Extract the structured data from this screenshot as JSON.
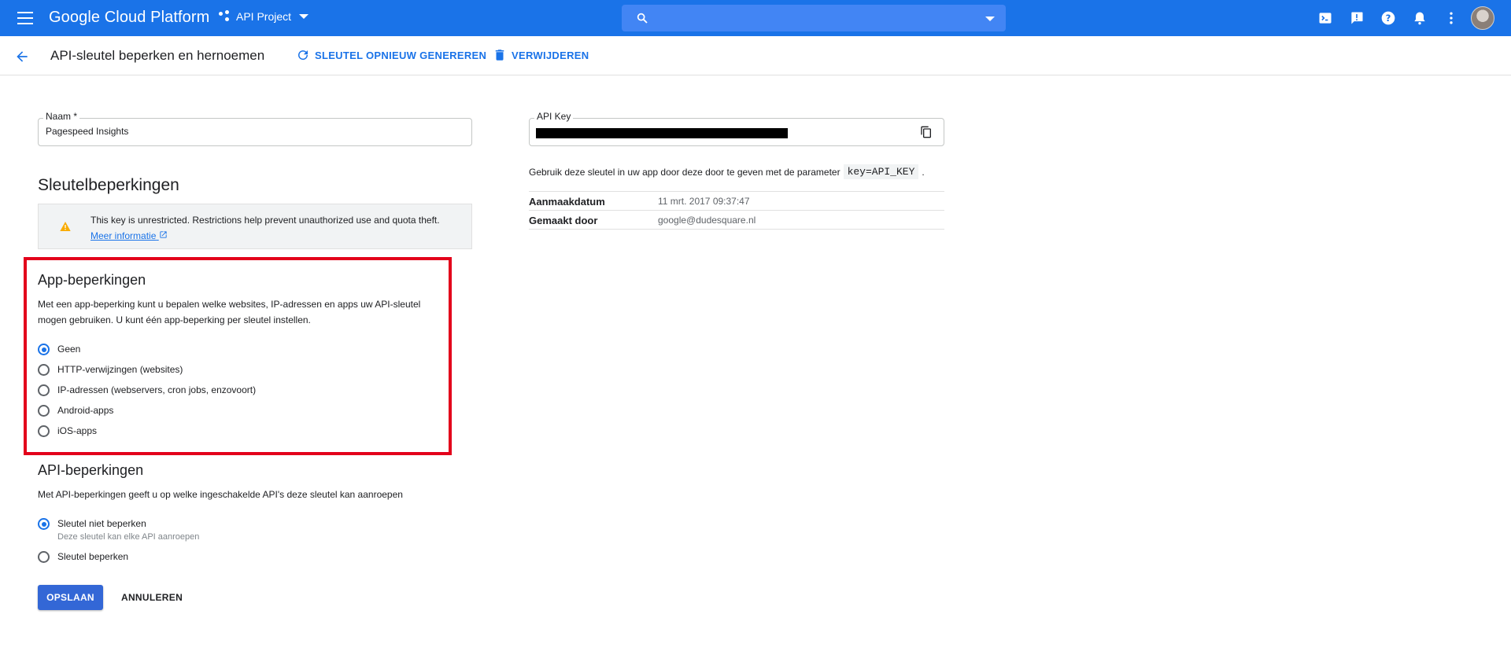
{
  "app": {
    "brand": "Google Cloud Platform",
    "project": "API Project",
    "colors": {
      "primary": "#1a73e8",
      "highlight_box": "#e3001b",
      "warning": "#f9ab00"
    },
    "icons": [
      "menu-icon",
      "project-icon",
      "search-icon",
      "cloud-shell-icon",
      "feedback-icon",
      "help-icon",
      "notifications-icon",
      "more-vert-icon",
      "avatar"
    ]
  },
  "subheader": {
    "title": "API-sleutel beperken en hernoemen",
    "regenerate": "SLEUTEL OPNIEUW GENEREREN",
    "delete": "VERWIJDEREN"
  },
  "name_field": {
    "label": "Naam *",
    "value": "Pagespeed Insights"
  },
  "key_restrictions": {
    "heading": "Sleutelbeperkingen",
    "warning_text": "This key is unrestricted. Restrictions help prevent unauthorized use and quota theft.",
    "warning_link": "Meer informatie"
  },
  "app_restrictions": {
    "heading": "App-beperkingen",
    "description": "Met een app-beperking kunt u bepalen welke websites, IP-adressen en apps uw API-sleutel mogen gebruiken. U kunt één app-beperking per sleutel instellen.",
    "options": [
      {
        "label": "Geen",
        "selected": true
      },
      {
        "label": "HTTP-verwijzingen (websites)",
        "selected": false
      },
      {
        "label": "IP-adressen (webservers, cron jobs, enzovoort)",
        "selected": false
      },
      {
        "label": "Android-apps",
        "selected": false
      },
      {
        "label": "iOS-apps",
        "selected": false
      }
    ]
  },
  "api_restrictions": {
    "heading": "API-beperkingen",
    "description": "Met API-beperkingen geeft u op welke ingeschakelde API's deze sleutel kan aanroepen",
    "options": [
      {
        "label": "Sleutel niet beperken",
        "sub": "Deze sleutel kan elke API aanroepen",
        "selected": true
      },
      {
        "label": "Sleutel beperken",
        "selected": false
      }
    ]
  },
  "buttons": {
    "save": "OPSLAAN",
    "cancel": "ANNULEREN"
  },
  "api_key": {
    "label": "API Key",
    "usage_before": "Gebruik deze sleutel in uw app door deze door te geven met de parameter",
    "usage_code": "key=API_KEY",
    "usage_after": ".",
    "rows": [
      {
        "key": "Aanmaakdatum",
        "value": "11 mrt. 2017 09:37:47"
      },
      {
        "key": "Gemaakt door",
        "value": "google@dudesquare.nl"
      }
    ]
  }
}
